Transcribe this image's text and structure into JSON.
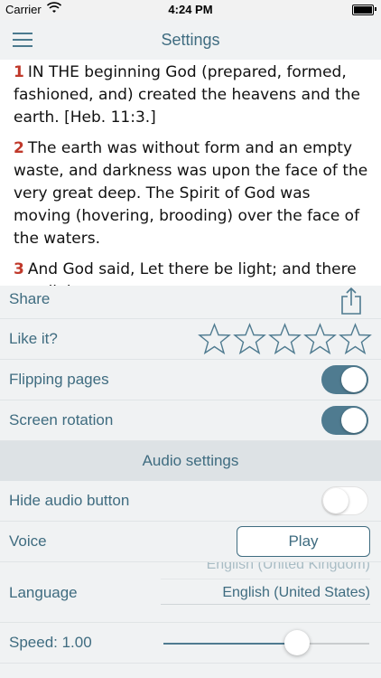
{
  "status_bar": {
    "carrier": "Carrier",
    "time": "4:24 PM"
  },
  "navbar": {
    "title": "Settings"
  },
  "verses": [
    {
      "num": "1",
      "text": "IN THE beginning God (prepared, formed, fashioned, and) created the heavens and the earth. [Heb. 11:3.]"
    },
    {
      "num": "2",
      "text": "The earth was without form and an empty waste, and darkness was upon the face of the very great deep. The Spirit of God was moving (hovering, brooding) over the face of the waters."
    },
    {
      "num": "3",
      "text": "And God said, Let there be light; and there was light."
    }
  ],
  "settings": {
    "share_label": "Share",
    "like_label": "Like it?",
    "rating": {
      "value": 0,
      "max": 5
    },
    "flipping_label": "Flipping pages",
    "flipping_on": true,
    "rotation_label": "Screen rotation",
    "rotation_on": true
  },
  "audio": {
    "header": "Audio settings",
    "hide_label": "Hide audio button",
    "hide_on": false,
    "voice_label": "Voice",
    "play_label": "Play",
    "language_label": "Language",
    "language_options": [
      "English (United Kingdom)",
      "English (United States)"
    ],
    "language_selected": "English (United States)",
    "speed_label": "Speed: 1.00",
    "speed_fraction": 0.65
  },
  "colors": {
    "accent": "#4f7b90",
    "verse_number": "#c0392b",
    "background": "#f0f2f3"
  }
}
